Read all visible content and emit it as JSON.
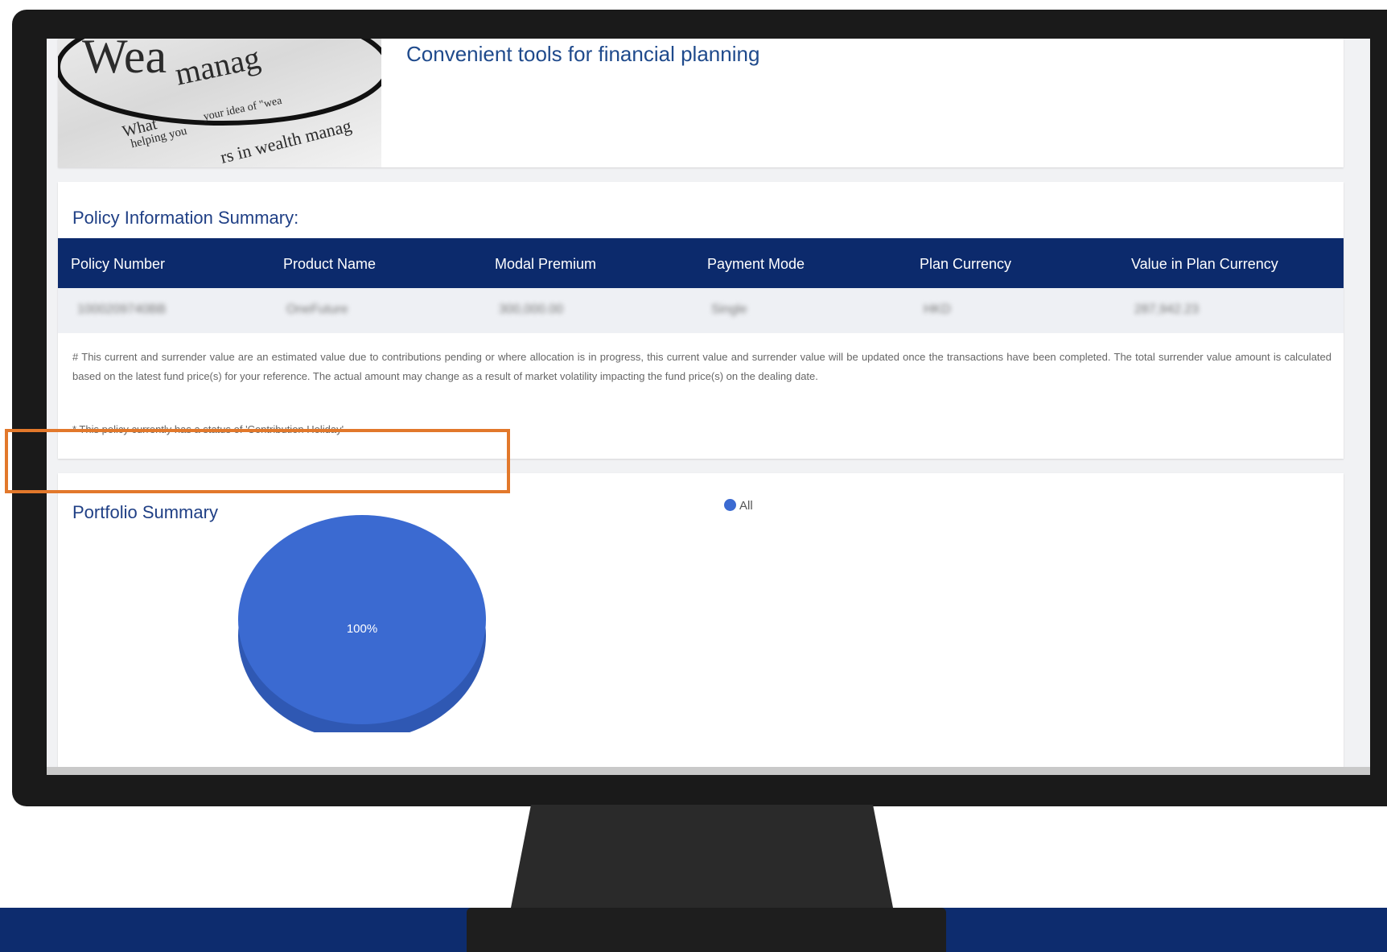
{
  "hero": {
    "tagline": "Convenient tools for financial planning",
    "image_text": {
      "word1": "Wea",
      "word2": "manag",
      "line1": "your idea of \"wea",
      "line2": "helping you",
      "line3": "rs in wealth manag",
      "line4": "What"
    }
  },
  "policy": {
    "title": "Policy Information Summary:",
    "columns": [
      "Policy Number",
      "Product Name",
      "Modal Premium",
      "Payment Mode",
      "Plan Currency",
      "Value in Plan Currency"
    ],
    "row": [
      "1000209740BB",
      "OneFuture",
      "300,000.00",
      "Single",
      "HKD",
      "287,942.23"
    ],
    "note_hash": "# This current and surrender value are an estimated value due to contributions pending or where allocation is in progress, this current value and surrender value will be updated once the transactions have been completed. The total surrender value amount is calculated based on the latest fund price(s) for your reference. The actual amount may change as a result of market volatility impacting the fund price(s) on the dealing date.",
    "note_star": "* This policy currently has a status of 'Contribution Holiday'"
  },
  "portfolio": {
    "title": "Portfolio Summary",
    "highlight_color": "#e2782b"
  },
  "chart_data": {
    "type": "pie",
    "categories": [
      "All"
    ],
    "values": [
      100
    ],
    "data_labels": [
      "100%"
    ],
    "legend_position": "top",
    "colors": [
      "#3b6ad1"
    ]
  },
  "colors": {
    "brand_navy": "#0c2a6c",
    "title_blue": "#1f3f85",
    "accent_orange": "#e2782b",
    "pie_blue": "#3b6ad1"
  }
}
